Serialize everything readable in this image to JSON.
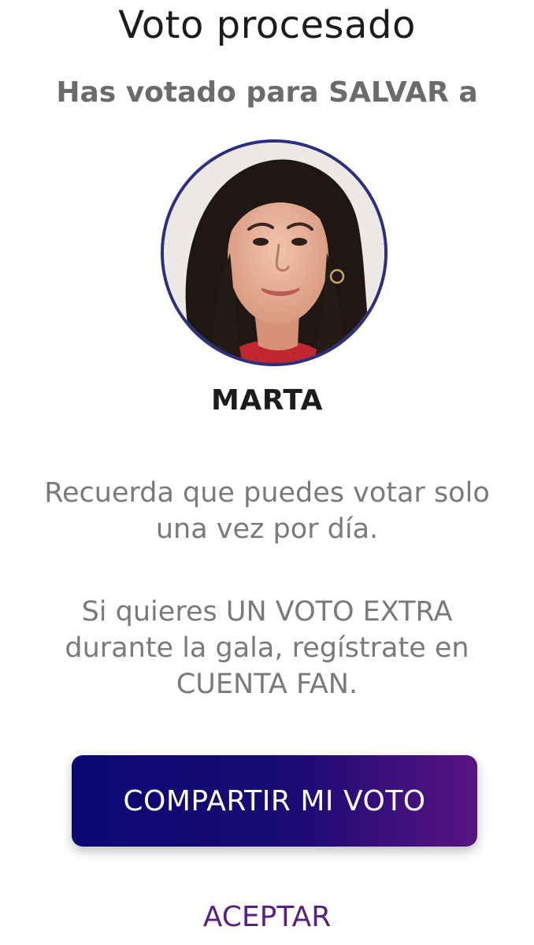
{
  "header": {
    "title": "Voto procesado",
    "subtitle": "Has votado para SALVAR a"
  },
  "contestant": {
    "name": "MARTA",
    "photo": "contestant-portrait"
  },
  "messages": {
    "line1a": "Recuerda que puedes votar solo",
    "line1b": "una vez por día.",
    "line2a": "Si quieres UN VOTO EXTRA",
    "line2b": "durante la gala, regístrate en",
    "line2c": "CUENTA FAN."
  },
  "actions": {
    "share_label": "COMPARTIR MI VOTO",
    "accept_label": "ACEPTAR"
  },
  "colors": {
    "avatar_ring": "#2d2e7f",
    "share_gradient_start": "#0a0872",
    "share_gradient_end": "#5a1482",
    "accept_text": "#5a1f86"
  }
}
